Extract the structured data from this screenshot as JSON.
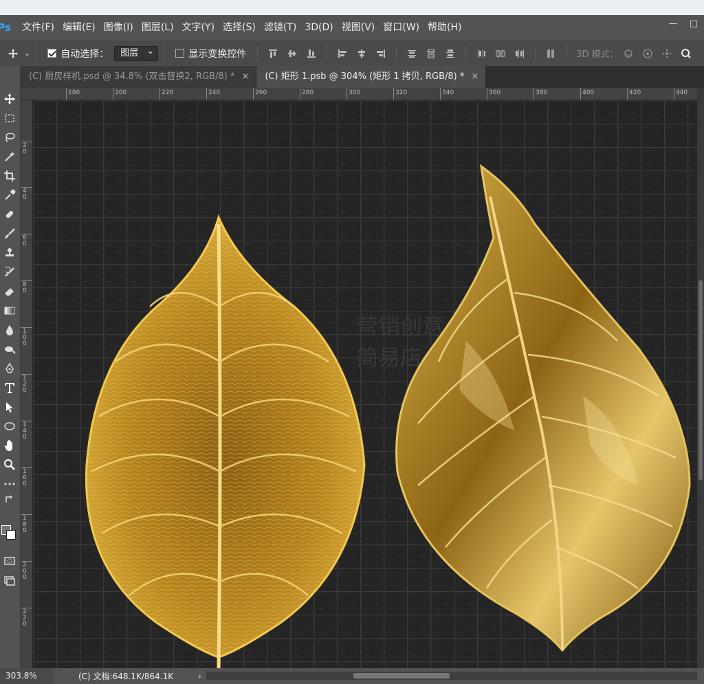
{
  "app": {
    "logo": "Ps"
  },
  "menu": {
    "items": [
      "文件(F)",
      "编辑(E)",
      "图像(I)",
      "图层(L)",
      "文字(Y)",
      "选择(S)",
      "滤镜(T)",
      "3D(D)",
      "视图(V)",
      "窗口(W)",
      "帮助(H)"
    ]
  },
  "window_controls": {
    "minimize": "—",
    "maximize": "□"
  },
  "options": {
    "auto_select_label": "自动选择：",
    "auto_select_checked": true,
    "target_value": "图层",
    "show_transform_label": "显示变换控件",
    "show_transform_checked": false,
    "mode_label": "3D 模式："
  },
  "tabs": [
    {
      "label": "(C) 厨房样机.psd @ 34.8% (双击替换2, RGB/8) *",
      "active": false,
      "close": "×"
    },
    {
      "label": "(C) 矩形 1.psb @ 304% (矩形 1 拷贝, RGB/8) *",
      "active": true,
      "close": "×"
    }
  ],
  "ruler_top": [
    "180",
    "200",
    "220",
    "240",
    "260",
    "280",
    "300",
    "320",
    "340",
    "360",
    "380",
    "400",
    "420",
    "440"
  ],
  "ruler_left": [
    "2 0",
    "4 0",
    "6 0",
    "8 0",
    "1 0 0",
    "1 2 0",
    "1 4 0",
    "1 6 0",
    "1 8 0",
    "2 0 0",
    "2 2 0"
  ],
  "watermark": {
    "line1": "营销创意",
    "line2": "简易店"
  },
  "status": {
    "zoom": "303.8%",
    "doc": "(C) 文档:648.1K/864.1K",
    "arrow": "›"
  },
  "colors": {
    "leaf_gold": "#c89a2a",
    "leaf_dark": "#6b4a0e",
    "bg_dark": "#252525"
  }
}
